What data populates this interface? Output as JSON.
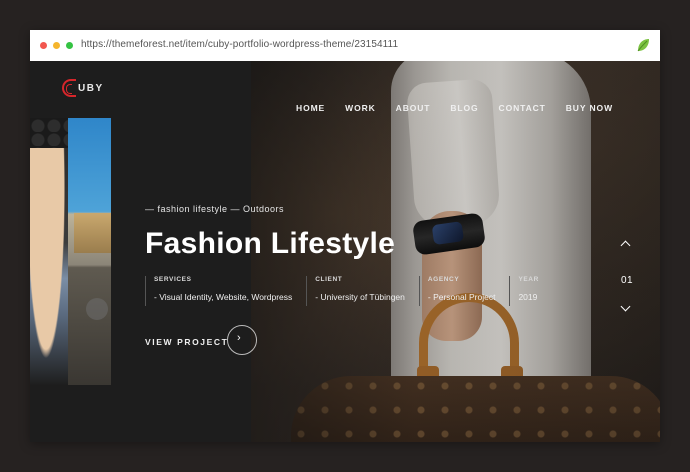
{
  "browser": {
    "url": "https://themeforest.net/item/cuby-portfolio-wordpress-theme/23154111",
    "extension_icon": "leaf-icon"
  },
  "colors": {
    "background": "#262221",
    "panel": "#1d1d1d",
    "logo_accent": "#d7262b",
    "text": "#ffffff"
  },
  "site": {
    "logo_letter": "C",
    "logo_text": "UBY",
    "nav": [
      {
        "label": "HOME"
      },
      {
        "label": "WORK"
      },
      {
        "label": "ABOUT"
      },
      {
        "label": "BLOG"
      },
      {
        "label": "CONTACT"
      },
      {
        "label": "BUY NOW"
      }
    ]
  },
  "project": {
    "caption": "— fashion lifestyle — Outdoors",
    "title": "Fashion Lifestyle",
    "meta": [
      {
        "label": "SERVICES",
        "value": "- Visual Identity, Website, Wordpress"
      },
      {
        "label": "CLIENT",
        "value": "- University of Tübingen"
      },
      {
        "label": "AGENCY",
        "value": "- Personal Project"
      },
      {
        "label": "YEAR",
        "value": "2019"
      }
    ],
    "view_label": "VIEW PROJECT",
    "view_arrow": "›"
  },
  "slider": {
    "current": "01"
  }
}
